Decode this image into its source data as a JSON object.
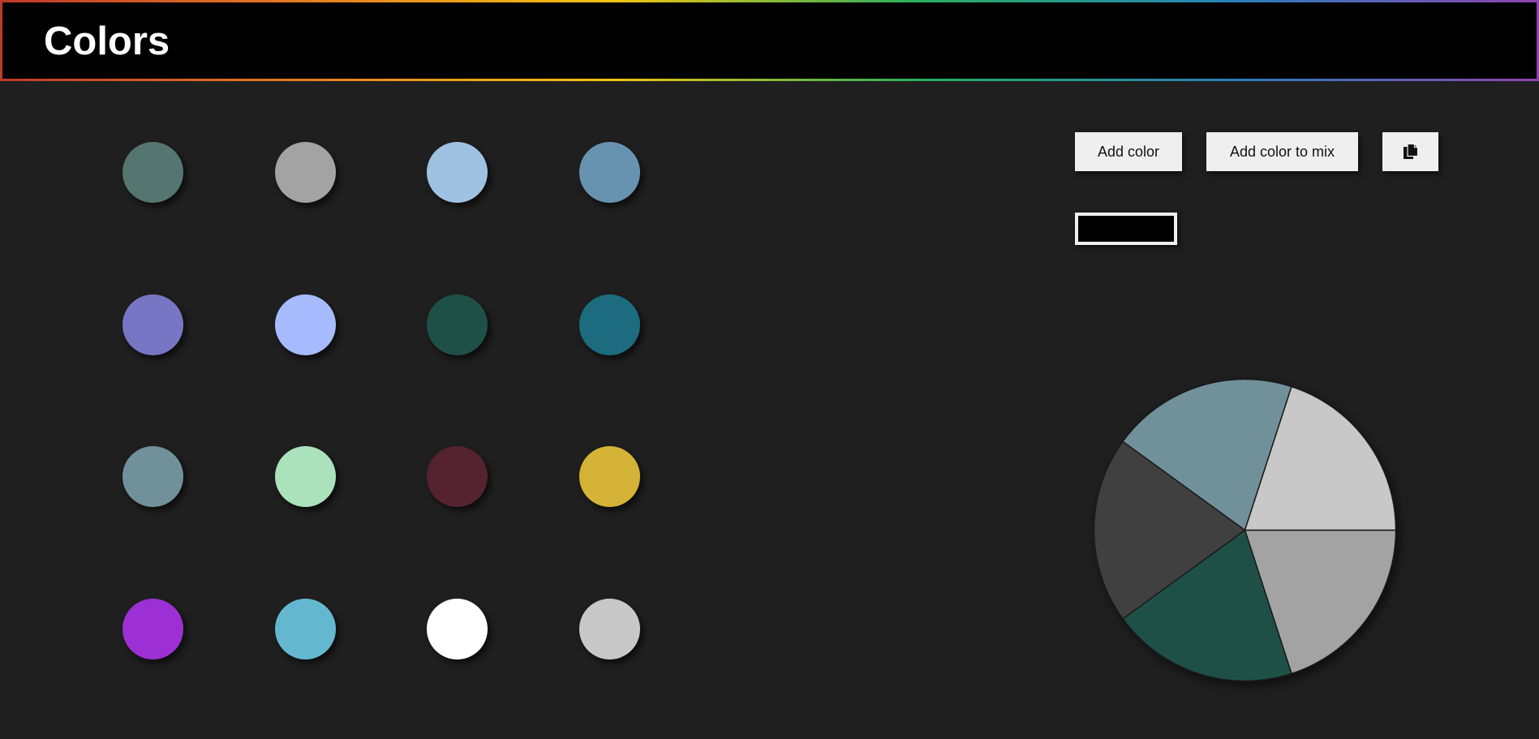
{
  "header": {
    "title": "Colors"
  },
  "swatches": [
    {
      "color": "#557570"
    },
    {
      "color": "#a3a3a3"
    },
    {
      "color": "#9fc2e2"
    },
    {
      "color": "#6893b0"
    },
    {
      "color": "#7676c4"
    },
    {
      "color": "#a5bbfe"
    },
    {
      "color": "#1f5048"
    },
    {
      "color": "#1d6b7e"
    },
    {
      "color": "#71919a"
    },
    {
      "color": "#abe2bb"
    },
    {
      "color": "#542231"
    },
    {
      "color": "#d4b337"
    },
    {
      "color": "#9c30d4"
    },
    {
      "color": "#63b8d0"
    },
    {
      "color": "#ffffff"
    },
    {
      "color": "#c8c8c8"
    }
  ],
  "toolbar": {
    "add_color_label": "Add color",
    "add_to_mix_label": "Add color to mix",
    "copy_icon": "copy-icon"
  },
  "mix_box": {
    "color": "#000000"
  },
  "chart_data": {
    "type": "pie",
    "values": [
      1,
      1,
      1,
      1,
      1
    ],
    "colors": [
      "#a3a3a3",
      "#1f5048",
      "#404040",
      "#71919a",
      "#c8c8c8"
    ],
    "start_angle_deg": 0,
    "direction": "clockwise"
  }
}
